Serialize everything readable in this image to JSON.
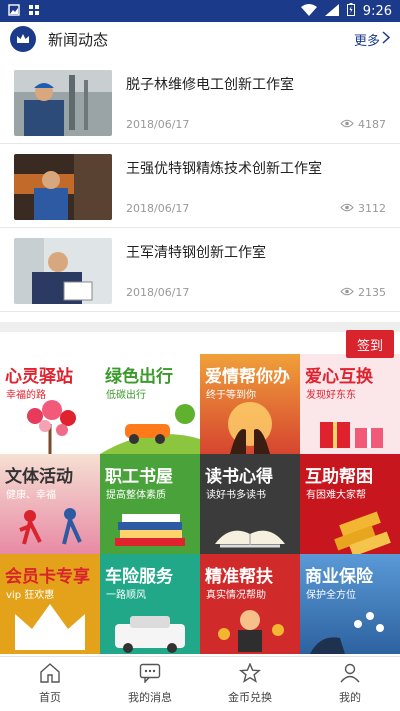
{
  "status_bar": {
    "time": "9:26"
  },
  "news": {
    "title": "新闻动态",
    "more_label": "更多",
    "items": [
      {
        "headline": "脱子林维修电工创新工作室",
        "date": "2018/06/17",
        "views": "4187"
      },
      {
        "headline": "王强优特钢精炼技术创新工作室",
        "date": "2018/06/17",
        "views": "3112"
      },
      {
        "headline": "王军清特钢创新工作室",
        "date": "2018/06/17",
        "views": "2135"
      }
    ]
  },
  "checkin_label": "签到",
  "tiles": [
    {
      "title": "心灵驿站",
      "sub": "幸福的路",
      "title_color": "#e0212e",
      "sub_color": "#e0212e",
      "bg": "#ffffff"
    },
    {
      "title": "绿色出行",
      "sub": "低碳出行",
      "title_color": "#3a9a2a",
      "sub_color": "#3a9a2a",
      "bg": "#ffffff"
    },
    {
      "title": "爱情帮你办",
      "sub": "终于等到你",
      "title_color": "#ffffff",
      "sub_color": "#ffffff",
      "bg": "#d6452f"
    },
    {
      "title": "爱心互换",
      "sub": "发现好东东",
      "title_color": "#e0212e",
      "sub_color": "#e0212e",
      "bg": "#fbe6ea"
    },
    {
      "title": "文体活动",
      "sub": "健康、幸福",
      "title_color": "#333333",
      "sub_color": "#ffffff",
      "bg": "#f2d8c8"
    },
    {
      "title": "职工书屋",
      "sub": "提高整体素质",
      "title_color": "#ffffff",
      "sub_color": "#ffffff",
      "bg": "#4aa23a"
    },
    {
      "title": "读书心得",
      "sub": "读好书多读书",
      "title_color": "#ffffff",
      "sub_color": "#ffffff",
      "bg": "#3b3b3b"
    },
    {
      "title": "互助帮困",
      "sub": "有困难大家帮",
      "title_color": "#ffffff",
      "sub_color": "#ffffff",
      "bg": "#c8161e"
    },
    {
      "title": "会员卡专享",
      "sub": "vip 狂欢惠",
      "title_color": "#d9232d",
      "sub_color": "#ffffff",
      "bg": "#e3a21a"
    },
    {
      "title": "车险服务",
      "sub": "一路顺风",
      "title_color": "#ffffff",
      "sub_color": "#ffffff",
      "bg": "#21a889"
    },
    {
      "title": "精准帮扶",
      "sub": "真实情况帮助",
      "title_color": "#ffffff",
      "sub_color": "#ffffff",
      "bg": "#d12a2a"
    },
    {
      "title": "商业保险",
      "sub": "保护全方位",
      "title_color": "#ffffff",
      "sub_color": "#ffffff",
      "bg": "#3e7fc0"
    }
  ],
  "bottom_nav": [
    {
      "label": "首页",
      "icon": "home-icon"
    },
    {
      "label": "我的消息",
      "icon": "message-icon"
    },
    {
      "label": "金币兑换",
      "icon": "star-icon"
    },
    {
      "label": "我的",
      "icon": "user-icon"
    }
  ],
  "colors": {
    "brand": "#1c3a8a",
    "accent_red": "#d9232d"
  }
}
